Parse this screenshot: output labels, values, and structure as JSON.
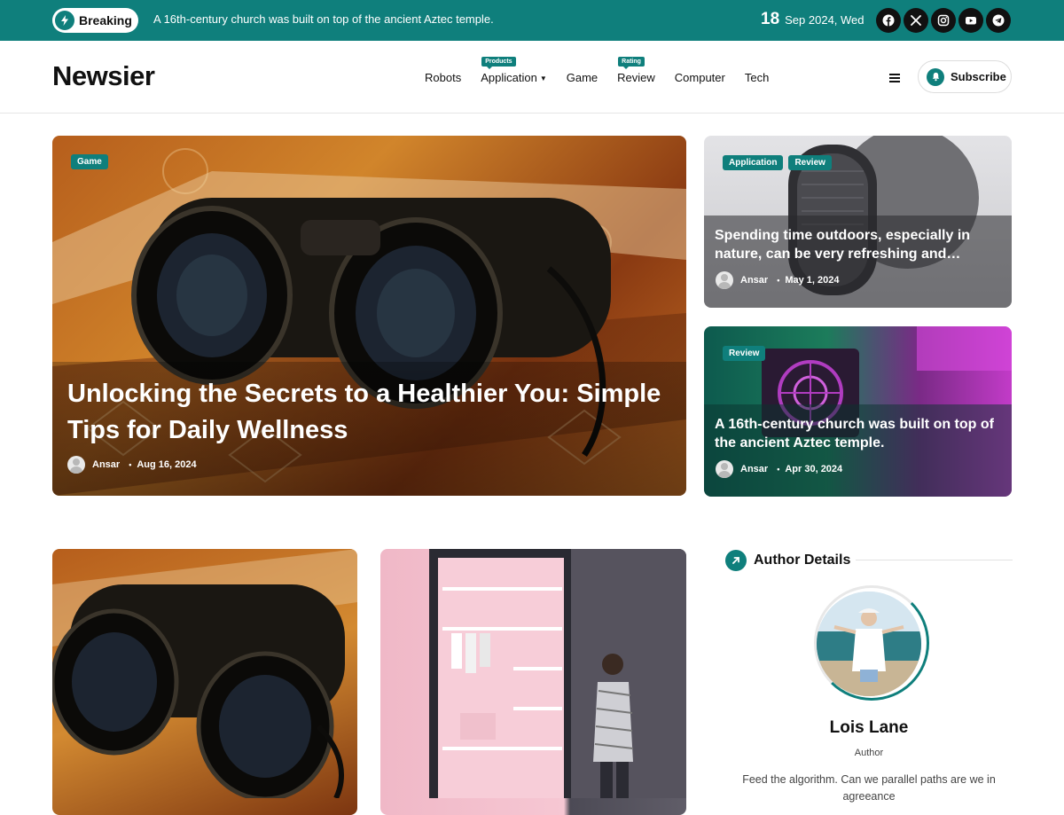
{
  "topbar": {
    "breaking_label": "Breaking",
    "ticker_text": "A 16th-century church was built on top of the ancient Aztec temple.",
    "date_day": "18",
    "date_rest": "Sep 2024, Wed",
    "socials": [
      "facebook-icon",
      "x-icon",
      "instagram-icon",
      "youtube-icon",
      "telegram-icon"
    ]
  },
  "header": {
    "logo": "Newsier",
    "nav": [
      {
        "label": "Robots",
        "tag": ""
      },
      {
        "label": "Application",
        "tag": "Products",
        "has_dropdown": true
      },
      {
        "label": "Game",
        "tag": ""
      },
      {
        "label": "Review",
        "tag": "Rating"
      },
      {
        "label": "Computer",
        "tag": ""
      },
      {
        "label": "Tech",
        "tag": ""
      }
    ],
    "subscribe_label": "Subscribe"
  },
  "featured": {
    "main": {
      "badges": [
        "Game"
      ],
      "title": "Unlocking the Secrets to a Healthier You: Simple Tips for Daily Wellness",
      "author": "Ansar",
      "date": "Aug 16, 2024"
    },
    "side": [
      {
        "badges": [
          "Application",
          "Review"
        ],
        "title": "Spending time outdoors, especially in nature, can be very refreshing and…",
        "author": "Ansar",
        "date": "May 1, 2024"
      },
      {
        "badges": [
          "Review"
        ],
        "title": "A 16th-century church was built on top of the ancient Aztec temple.",
        "author": "Ansar",
        "date": "Apr 30, 2024"
      }
    ]
  },
  "author_widget": {
    "heading": "Author Details",
    "name": "Lois Lane",
    "role": "Author",
    "bio": "Feed the algorithm. Can we parallel paths are we in agreeance"
  },
  "colors": {
    "accent": "#0f7f7c",
    "topbar": "#0f7f7c"
  }
}
